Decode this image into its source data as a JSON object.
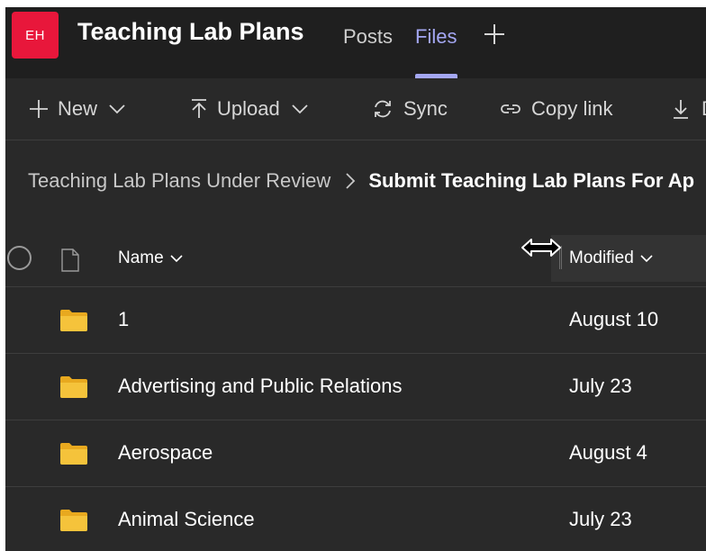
{
  "header": {
    "avatar_initials": "EH",
    "team_name": "Teaching Lab Plans",
    "tabs": [
      {
        "label": "Posts",
        "active": false
      },
      {
        "label": "Files",
        "active": true
      }
    ],
    "add_tab_icon": "plus-icon"
  },
  "toolbar": {
    "new_label": "New",
    "upload_label": "Upload",
    "sync_label": "Sync",
    "copy_link_label": "Copy link",
    "download_label": "D"
  },
  "breadcrumb": {
    "parent": "Teaching Lab Plans Under Review",
    "current": "Submit Teaching Lab Plans For Ap"
  },
  "columns": {
    "name": "Name",
    "modified": "Modified"
  },
  "rows": [
    {
      "name": "1",
      "modified": "August 10",
      "icon": "folder-icon"
    },
    {
      "name": "Advertising and Public Relations",
      "modified": "July 23",
      "icon": "folder-icon"
    },
    {
      "name": "Aerospace",
      "modified": "August 4",
      "icon": "folder-icon"
    },
    {
      "name": "Animal Science",
      "modified": "July 23",
      "icon": "folder-icon"
    }
  ],
  "colors": {
    "avatar_bg": "#e8173b",
    "active_tab": "#a4a7f3",
    "folder": "#f5c33b",
    "background": "#292929",
    "header_bg": "#1f1f1f"
  }
}
